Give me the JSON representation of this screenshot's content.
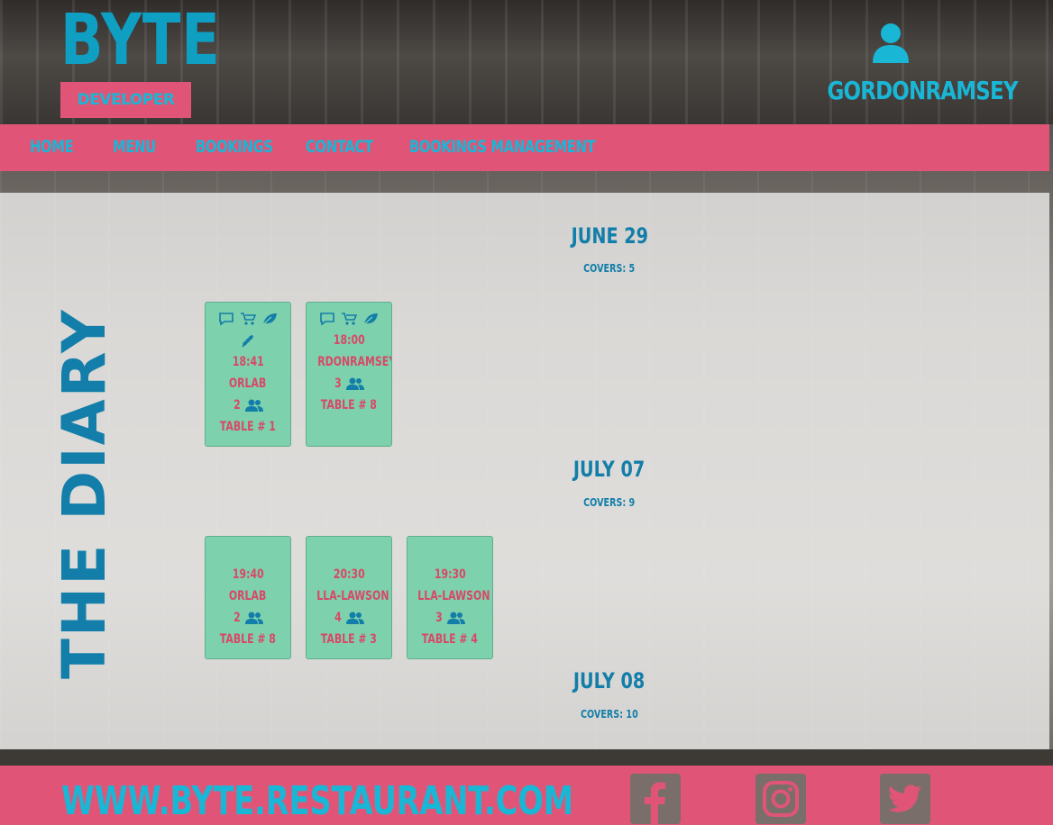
{
  "brand": {
    "name": "BYTE",
    "tagline": "DEVELOPER DINER"
  },
  "user": {
    "name": "GORDONRAMSEY",
    "icon": "user-icon"
  },
  "nav": {
    "items": [
      {
        "label": "HOME"
      },
      {
        "label": "MENU"
      },
      {
        "label": "BOOKINGS"
      },
      {
        "label": "CONTACT"
      },
      {
        "label": "BOOKINGS MANAGEMENT"
      }
    ]
  },
  "diary": {
    "title": "THE DIARY",
    "days": [
      {
        "date": "JUNE 29",
        "covers": "COVERS: 5",
        "bookings": [
          {
            "icons": [
              "comment-icon",
              "stroller-icon",
              "leaf-icon",
              "wheat-icon"
            ],
            "time": "18:41",
            "name": "ORLAB",
            "guests": "2",
            "table": "TABLE # 1"
          },
          {
            "icons": [
              "comment-icon",
              "stroller-icon",
              "leaf-icon"
            ],
            "time": "18:00",
            "name": "RDONRAMSEY",
            "guests": "3",
            "table": "TABLE # 8"
          }
        ]
      },
      {
        "date": "JULY 07",
        "covers": "COVERS: 9",
        "bookings": [
          {
            "icons": [],
            "time": "19:40",
            "name": "ORLAB",
            "guests": "2",
            "table": "TABLE # 8"
          },
          {
            "icons": [],
            "time": "20:30",
            "name": "LLA-LAWSON",
            "guests": "4",
            "table": "TABLE # 3"
          },
          {
            "icons": [],
            "time": "19:30",
            "name": "LLA-LAWSON",
            "guests": "3",
            "table": "TABLE # 4"
          }
        ]
      },
      {
        "date": "JULY 08",
        "covers": "COVERS: 10",
        "bookings": []
      }
    ]
  },
  "footer": {
    "url": "WWW.BYTE.RESTAURANT.COM",
    "social": [
      {
        "icon": "facebook-icon"
      },
      {
        "icon": "instagram-icon"
      },
      {
        "icon": "twitter-icon"
      }
    ]
  },
  "colors": {
    "pink": "#e05577",
    "cyan": "#19b6d6",
    "blue": "#127ea9",
    "card": "#7ed1ad"
  }
}
